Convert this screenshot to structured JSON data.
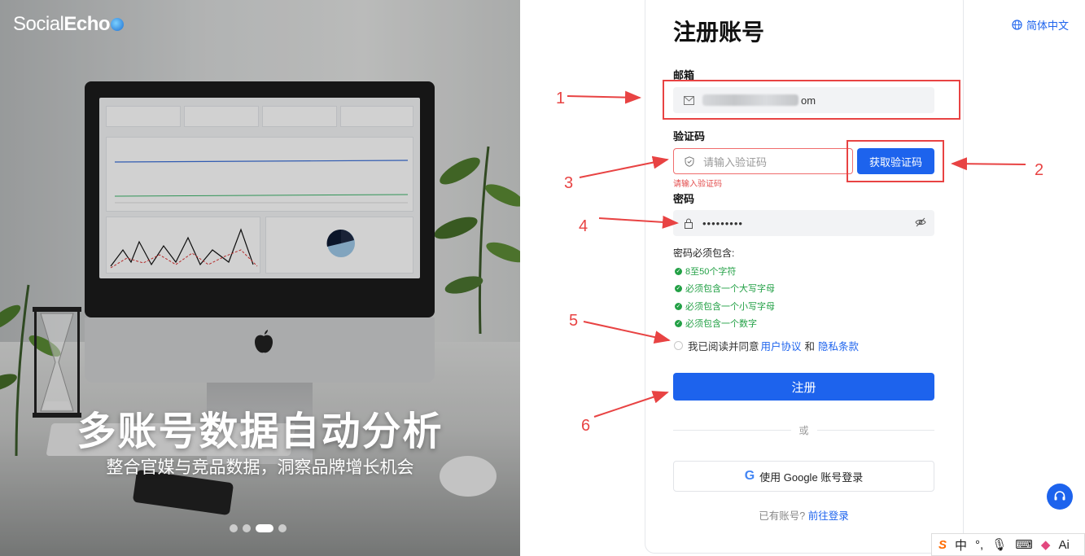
{
  "hero": {
    "brand_part1": "Social",
    "brand_part2": "Echo",
    "title": "多账号数据自动分析",
    "subtitle": "整合官媒与竞品数据，洞察品牌增长机会",
    "carousel_dots": 4,
    "carousel_active_index": 2
  },
  "header": {
    "language": "简体中文"
  },
  "form": {
    "title": "注册账号",
    "email_label": "邮箱",
    "email_suffix": "om",
    "code_label": "验证码",
    "code_placeholder": "请输入验证码",
    "send_code_button": "获取验证码",
    "code_error": "请输入验证码",
    "password_label": "密码",
    "password_value": "•••••••••",
    "requirements_title": "密码必须包含:",
    "requirements": [
      "8至50个字符",
      "必须包含一个大写字母",
      "必须包含一个小写字母",
      "必须包含一个数字"
    ],
    "agree_prefix": "我已阅读并同意",
    "agree_terms": "用户协议",
    "agree_and": "和",
    "agree_privacy": "隐私条款",
    "register_button": "注册",
    "or_text": "或",
    "google_button": "使用 Google 账号登录",
    "login_prompt": "已有账号?",
    "login_link": "前往登录"
  },
  "annotations": [
    "1",
    "2",
    "3",
    "4",
    "5",
    "6"
  ],
  "ime_bar": {
    "brand": "S",
    "mode": "中",
    "punct": "°,",
    "ai": "Ai"
  },
  "colors": {
    "accent": "#1d63ed",
    "annotation": "#e84343",
    "success": "#22a045",
    "error": "#e34d4d"
  }
}
